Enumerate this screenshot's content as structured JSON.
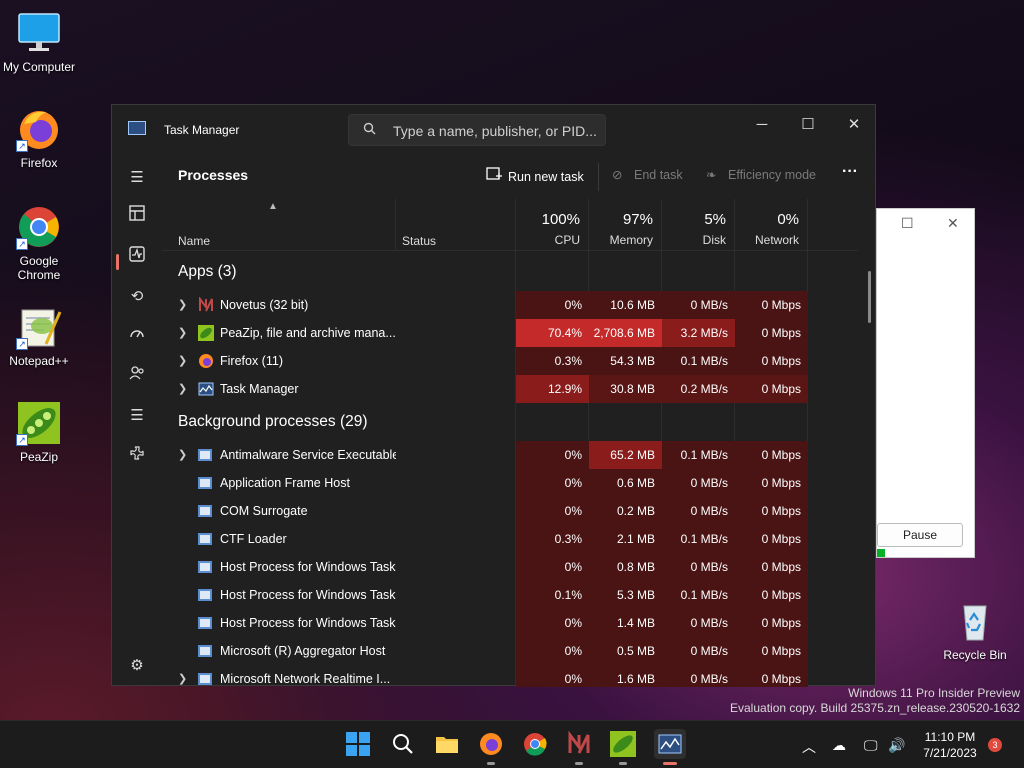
{
  "desktop": {
    "icons": [
      {
        "label": "My Computer"
      },
      {
        "label": "Firefox"
      },
      {
        "label": "Google Chrome"
      },
      {
        "label": "Notepad++"
      },
      {
        "label": "PeaZip"
      },
      {
        "label": "Recycle Bin"
      }
    ],
    "watermark": {
      "line1": "Windows 11 Pro Insider Preview",
      "line2": "Evaluation copy. Build 25375.zn_release.230520-1632"
    }
  },
  "background_window": {
    "pause_label": "Pause"
  },
  "task_manager": {
    "title": "Task Manager",
    "search_placeholder": "Type a name, publisher, or PID...",
    "page_heading": "Processes",
    "toolbar": {
      "run_new_task": "Run new task",
      "end_task": "End task",
      "efficiency_mode": "Efficiency mode",
      "more": "···"
    },
    "columns": {
      "name": "Name",
      "status": "Status",
      "cpu": {
        "pct": "100%",
        "label": "CPU"
      },
      "memory": {
        "pct": "97%",
        "label": "Memory"
      },
      "disk": {
        "pct": "5%",
        "label": "Disk"
      },
      "network": {
        "pct": "0%",
        "label": "Network"
      }
    },
    "groups": {
      "apps": "Apps (3)",
      "background": "Background processes (29)"
    },
    "apps": [
      {
        "name": "Novetus (32 bit)",
        "cpu": "0%",
        "memory": "10.6 MB",
        "disk": "0 MB/s",
        "network": "0 Mbps"
      },
      {
        "name": "PeaZip, file and archive mana...",
        "cpu": "70.4%",
        "memory": "2,708.6 MB",
        "disk": "3.2 MB/s",
        "network": "0 Mbps"
      },
      {
        "name": "Firefox (11)",
        "cpu": "0.3%",
        "memory": "54.3 MB",
        "disk": "0.1 MB/s",
        "network": "0 Mbps"
      },
      {
        "name": "Task Manager",
        "cpu": "12.9%",
        "memory": "30.8 MB",
        "disk": "0.2 MB/s",
        "network": "0 Mbps"
      }
    ],
    "background": [
      {
        "name": "Antimalware Service Executable",
        "cpu": "0%",
        "memory": "65.2 MB",
        "disk": "0.1 MB/s",
        "network": "0 Mbps"
      },
      {
        "name": "Application Frame Host",
        "cpu": "0%",
        "memory": "0.6 MB",
        "disk": "0 MB/s",
        "network": "0 Mbps"
      },
      {
        "name": "COM Surrogate",
        "cpu": "0%",
        "memory": "0.2 MB",
        "disk": "0 MB/s",
        "network": "0 Mbps"
      },
      {
        "name": "CTF Loader",
        "cpu": "0.3%",
        "memory": "2.1 MB",
        "disk": "0.1 MB/s",
        "network": "0 Mbps"
      },
      {
        "name": "Host Process for Windows Tasks",
        "cpu": "0%",
        "memory": "0.8 MB",
        "disk": "0 MB/s",
        "network": "0 Mbps"
      },
      {
        "name": "Host Process for Windows Tasks",
        "cpu": "0.1%",
        "memory": "5.3 MB",
        "disk": "0.1 MB/s",
        "network": "0 Mbps"
      },
      {
        "name": "Host Process for Windows Tasks",
        "cpu": "0%",
        "memory": "1.4 MB",
        "disk": "0 MB/s",
        "network": "0 Mbps"
      },
      {
        "name": "Microsoft (R) Aggregator Host",
        "cpu": "0%",
        "memory": "0.5 MB",
        "disk": "0 MB/s",
        "network": "0 Mbps"
      },
      {
        "name": "Microsoft Network Realtime I...",
        "cpu": "0%",
        "memory": "1.6 MB",
        "disk": "0 MB/s",
        "network": "0 Mbps"
      }
    ]
  },
  "taskbar": {
    "time": "11:10 PM",
    "date": "7/21/2023",
    "notification_count": "3"
  },
  "colors": {
    "heat1": "#4a1414",
    "heat3": "#8a1c1c",
    "heat5": "#c42a2a",
    "accent": "#e9736a"
  }
}
